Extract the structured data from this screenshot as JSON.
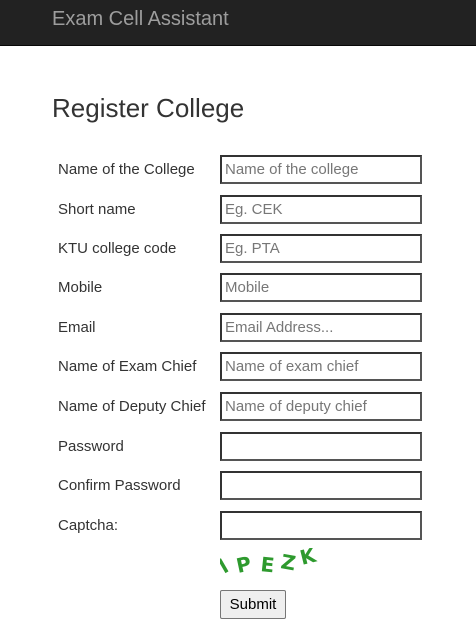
{
  "navbar": {
    "brand": "Exam Cell Assistant"
  },
  "page": {
    "title": "Register College"
  },
  "form": {
    "fields": [
      {
        "label": "Name of the College",
        "placeholder": "Name of the college",
        "type": "text"
      },
      {
        "label": "Short name",
        "placeholder": "Eg. CEK",
        "type": "text"
      },
      {
        "label": "KTU college code",
        "placeholder": "Eg. PTA",
        "type": "text"
      },
      {
        "label": "Mobile",
        "placeholder": "Mobile",
        "type": "text"
      },
      {
        "label": "Email",
        "placeholder": "Email Address...",
        "type": "text"
      },
      {
        "label": "Name of Exam Chief",
        "placeholder": "Name of exam chief",
        "type": "text"
      },
      {
        "label": "Name of Deputy Chief",
        "placeholder": "Name of deputy chief",
        "type": "text"
      },
      {
        "label": "Password",
        "placeholder": "",
        "type": "password"
      },
      {
        "label": "Confirm Password",
        "placeholder": "",
        "type": "password"
      },
      {
        "label": "Captcha:",
        "placeholder": "",
        "type": "text"
      }
    ],
    "captcha_text": "lPEZK",
    "captcha_color": "#2e9a2e",
    "submit_label": "Submit"
  }
}
